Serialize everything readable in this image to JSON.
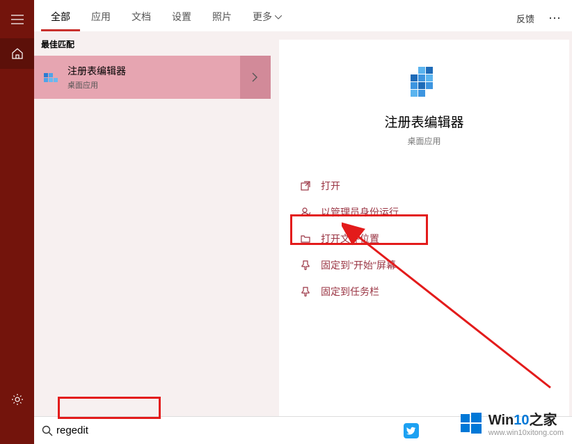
{
  "rail": {},
  "tabs": {
    "items": [
      {
        "label": "全部",
        "active": true
      },
      {
        "label": "应用"
      },
      {
        "label": "文档"
      },
      {
        "label": "设置"
      },
      {
        "label": "照片"
      },
      {
        "label": "更多"
      }
    ],
    "feedback": "反馈"
  },
  "results": {
    "best_match_header": "最佳匹配",
    "item": {
      "title": "注册表编辑器",
      "subtitle": "桌面应用"
    }
  },
  "detail": {
    "title": "注册表编辑器",
    "subtitle": "桌面应用",
    "actions": [
      {
        "icon": "open",
        "label": "打开"
      },
      {
        "icon": "admin",
        "label": "以管理员身份运行"
      },
      {
        "icon": "folder",
        "label": "打开文件位置"
      },
      {
        "icon": "pin-start",
        "label": "固定到\"开始\"屏幕"
      },
      {
        "icon": "pin-taskbar",
        "label": "固定到任务栏"
      }
    ]
  },
  "search": {
    "value": "regedit"
  },
  "watermark": {
    "brand1": "Win",
    "brand2": "10",
    "brand3": "之家",
    "url": "www.win10xitong.com"
  }
}
